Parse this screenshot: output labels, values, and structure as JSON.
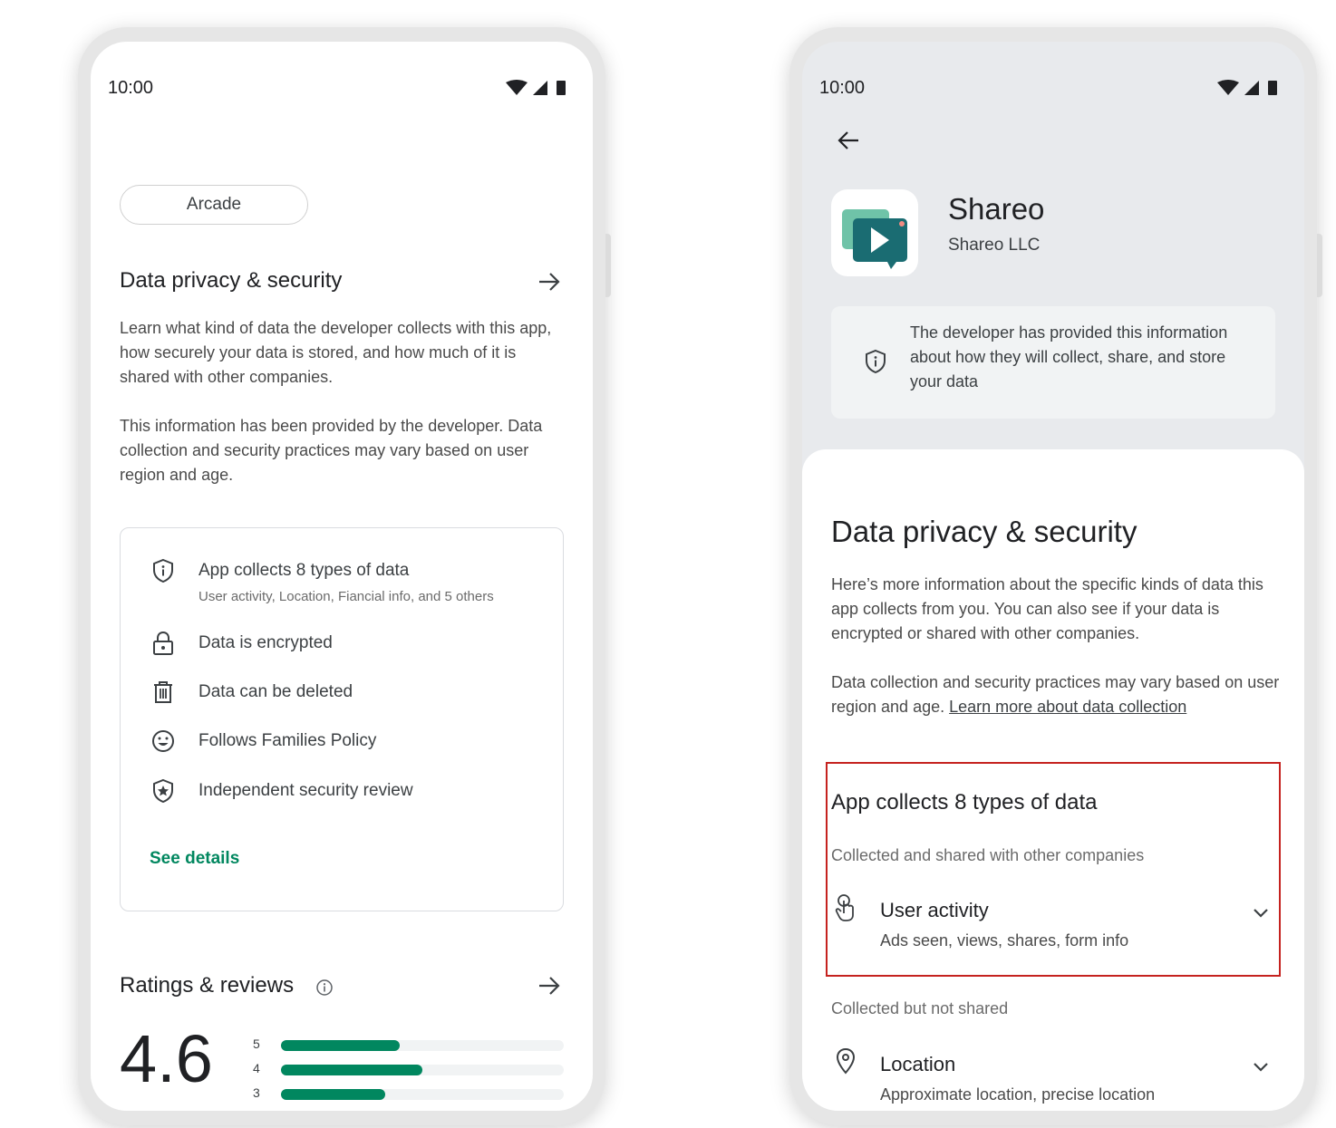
{
  "left_phone": {
    "status_time": "10:00",
    "chip_label": "Arcade",
    "data_privacy": {
      "title": "Data privacy & security",
      "paragraph1": "Learn what kind of data the developer collects with this app, how securely your data is stored, and how much of it is shared with other companies.",
      "paragraph2": "This information has been provided by the developer. Data collection and security practices may vary based on user region and age.",
      "card_items": [
        {
          "icon": "shield-info-icon",
          "label": "App collects 8 types of data",
          "sublabel": "User activity, Location, Fiancial info, and 5 others"
        },
        {
          "icon": "lock-icon",
          "label": "Data is encrypted"
        },
        {
          "icon": "trash-icon",
          "label": "Data can be deleted"
        },
        {
          "icon": "smiley-icon",
          "label": "Follows Families Policy"
        },
        {
          "icon": "shield-star-icon",
          "label": "Independent security review"
        }
      ],
      "see_details": "See details"
    },
    "ratings": {
      "title": "Ratings & reviews",
      "score": "4.6",
      "bars": [
        {
          "label": "5",
          "fraction": 0.42
        },
        {
          "label": "4",
          "fraction": 0.5
        },
        {
          "label": "3",
          "fraction": 0.37
        }
      ]
    }
  },
  "right_phone": {
    "status_time": "10:00",
    "app": {
      "name": "Shareo",
      "developer": "Shareo LLC",
      "info_text": "The developer has provided this information about how they will collect, share, and store your data"
    },
    "sheet": {
      "title": "Data privacy & security",
      "paragraph1": "Here’s more information about the specific kinds of data this app collects from you. You can also see if your data is encrypted or shared with other companies.",
      "paragraph2_prefix": "Data collection and security practices may vary based on user region and age. ",
      "paragraph2_link": "Learn more about data collection",
      "collects_title": "App collects 8 types of data",
      "groups": [
        {
          "heading": "Collected and shared with other companies",
          "items": [
            {
              "icon": "touch-hand-icon",
              "title": "User activity",
              "subtitle": "Ads seen, views, shares, form info"
            }
          ]
        },
        {
          "heading": "Collected but not shared",
          "items": [
            {
              "icon": "location-pin-icon",
              "title": "Location",
              "subtitle": "Approximate location, precise location"
            }
          ]
        }
      ]
    }
  },
  "colors": {
    "accent_green": "#01875f",
    "highlight_red": "#c5221f"
  }
}
